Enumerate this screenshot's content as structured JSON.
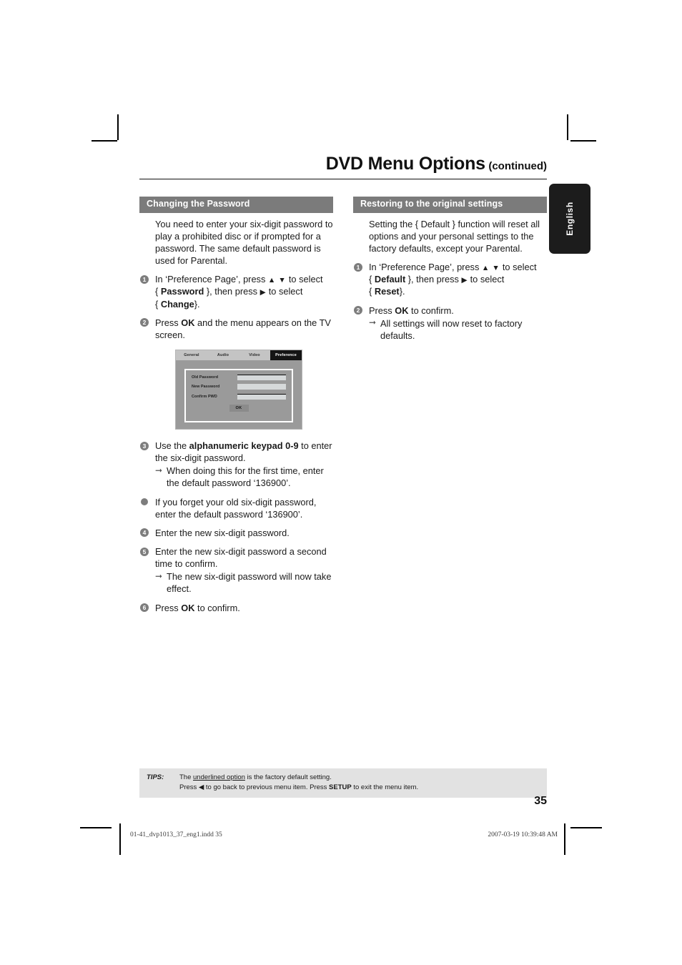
{
  "header": {
    "title_main": "DVD Menu Options",
    "title_sub": "(continued)"
  },
  "lang_tab": {
    "label": "English"
  },
  "left_column": {
    "section_title": "Changing the Password",
    "intro": "You need to enter your six-digit password to play a prohibited disc or if prompted for a password. The same default password is used for Parental.",
    "steps": [
      {
        "num": "1",
        "html_key": "step1"
      },
      {
        "num": "2",
        "html_key": "step2"
      },
      {
        "num": "3",
        "html_key": "step3"
      },
      {
        "num": "●",
        "html_key": "bullet"
      },
      {
        "num": "4",
        "html_key": "step4"
      },
      {
        "num": "5",
        "html_key": "step5"
      },
      {
        "num": "6",
        "html_key": "step6"
      }
    ],
    "step1_a": "In ‘Preference Page’, press",
    "step1_up": "▲",
    "step1_down": "▼",
    "step1_b": "to select",
    "step1_brace_open": "{",
    "step1_bold1": "Password",
    "step1_brace_close": "}, then press",
    "step1_right": "▶",
    "step1_c": "to select",
    "step1_d": "{",
    "step1_bold2": "Change",
    "step1_e": "}.",
    "step2_a": "Press",
    "step2_bold": "OK",
    "step2_b": "and the menu appears on the TV screen.",
    "step3_a": "Use the",
    "step3_bold": "alphanumeric keypad 0-9",
    "step3_b": "to enter the six-digit password.",
    "step3_sub": "When doing this for the first time, enter the default password ‘136900’.",
    "bullet_text": "If you forget your old six-digit password, enter the default password ‘136900’.",
    "step4_text": "Enter the new six-digit password.",
    "step5_text": "Enter the new six-digit password a second time to confirm.",
    "step5_sub": "The new six-digit password will now take effect.",
    "step6_a": "Press",
    "step6_bold": "OK",
    "step6_b": "to confirm."
  },
  "tv_screen": {
    "tabs": [
      {
        "label": "General",
        "active": false
      },
      {
        "label": "Audio",
        "active": false
      },
      {
        "label": "Video",
        "active": false
      },
      {
        "label": "Preference",
        "active": true
      }
    ],
    "fields": [
      {
        "label": "Old Password",
        "value": ""
      },
      {
        "label": "New Password",
        "value": ""
      },
      {
        "label": "Confirm PWD",
        "value": ""
      }
    ],
    "ok_label": "OK"
  },
  "right_column": {
    "section_title": "Restoring to the original settings",
    "intro": "Setting the { Default } function will reset all options and your personal settings to the factory defaults, except your Parental.",
    "step1_a": "In ‘Preference Page’, press",
    "step1_up": "▲",
    "step1_down": "▼",
    "step1_b": "to select",
    "step1_brace_open": "{",
    "step1_bold1": "Default",
    "step1_brace_close": "}, then press",
    "step1_right": "▶",
    "step1_c": "to select",
    "step1_d": "{",
    "step1_bold2": "Reset",
    "step1_e": "}.",
    "step2_a": "Press",
    "step2_bold": "OK",
    "step2_b": "to confirm.",
    "step2_sub": "All settings will now reset to factory defaults.",
    "num1": "1",
    "num2": "2"
  },
  "tips": {
    "label": "TIPS:",
    "line1_a": "The",
    "line1_underlined": "underlined option",
    "line1_b": "is the factory default setting.",
    "line2_a": "Press",
    "line2_arrow": "◀",
    "line2_b": "to go back to previous menu item. Press",
    "line2_bold": "SETUP",
    "line2_c": "to exit the menu item."
  },
  "page_number": "35",
  "imprint": {
    "left": "01-41_dvp1013_37_eng1.indd   35",
    "right": "2007-03-19   10:39:48 AM"
  },
  "colors": {
    "section_header_bg": "#7b7b7b",
    "tips_bg": "#e2e2e2",
    "lang_tab_bg": "#1c1c1c",
    "bullet_grey": "#7d7d7d",
    "tv_bg": "#9a9a9a",
    "tv_tab_bar": "#c4c4c4",
    "tv_active_tab": "#141414"
  }
}
